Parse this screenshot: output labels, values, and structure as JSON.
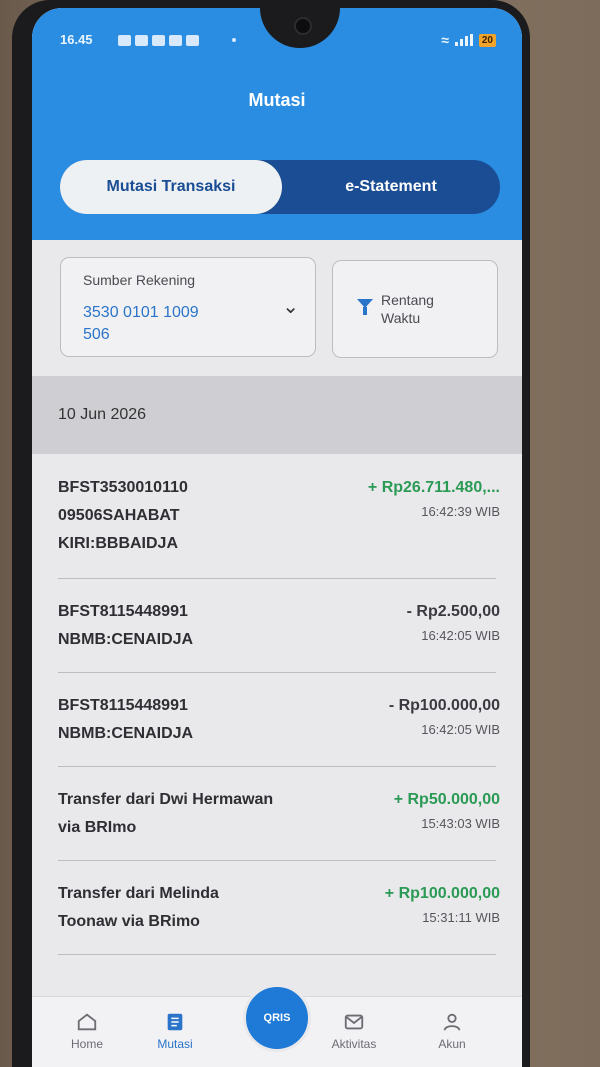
{
  "status_bar": {
    "time": "16.45",
    "battery": "20"
  },
  "header": {
    "title": "Mutasi"
  },
  "tabs": [
    {
      "label": "Mutasi Transaksi"
    },
    {
      "label": "e-Statement"
    }
  ],
  "filters": {
    "source_label": "Sumber Rekening",
    "account_line1": "3530 0101 1009",
    "account_line2": "506",
    "range_label_line1": "Rentang",
    "range_label_line2": "Waktu"
  },
  "date_header": "10 Jun 2026",
  "transactions": [
    {
      "line1": "BFST3530010110",
      "line2": "09506SAHABAT",
      "line3": "KIRI:BBBAIDJA",
      "amount": "+ Rp26.711.480,...",
      "time": "16:42:39 WIB"
    },
    {
      "line1": "BFST8115448991",
      "line2": "NBMB:CENAIDJA",
      "amount": "- Rp2.500,00",
      "time": "16:42:05 WIB"
    },
    {
      "line1": "BFST8115448991",
      "line2": "NBMB:CENAIDJA",
      "amount": "- Rp100.000,00",
      "time": "16:42:05 WIB"
    },
    {
      "line1": "Transfer dari Dwi Hermawan",
      "line2": "via BRImo",
      "amount": "+ Rp50.000,00",
      "time": "15:43:03 WIB"
    },
    {
      "line1": "Transfer dari Melinda",
      "line2": "Toonaw via BRimo",
      "amount": "+ Rp100.000,00",
      "time": "15:31:11 WIB"
    }
  ],
  "bottom_nav": {
    "home": "Home",
    "mutasi": "Mutasi",
    "qris": "QRIS",
    "aktivitas": "Aktivitas",
    "akun": "Akun"
  },
  "colors": {
    "primary": "#2a8de2",
    "tab_bg": "#1a4d93",
    "credit": "#2a9a55"
  }
}
